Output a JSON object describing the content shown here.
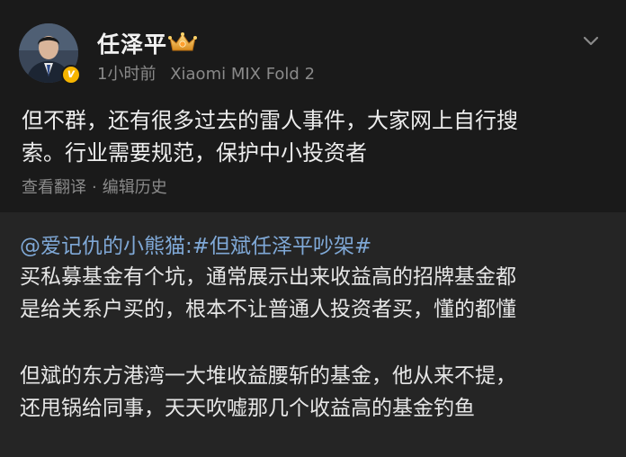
{
  "post": {
    "author": {
      "name": "任泽平"
    },
    "time": "1小时前",
    "device": "Xiaomi MIX Fold 2",
    "text_line1": "但不群，还有很多过去的雷人事件，大家网上自行搜",
    "text_line2": "索。行业需要规范，保护中小投资者",
    "actions": {
      "translate": "查看翻译",
      "separator": "·",
      "edit_history": "编辑历史"
    }
  },
  "repost": {
    "mention": "@爱记仇的小熊猫",
    "colon": ":",
    "topic": "#但斌任泽平吵架#",
    "para1_line1": "买私募基金有个坑，通常展示出来收益高的招牌基金都",
    "para1_line2": "是给关系户买的，根本不让普通人投资者买，懂的都懂",
    "para2_line1": "但斌的东方港湾一大堆收益腰斩的基金，他从来不提，",
    "para2_line2": "还甩锅给同事，天天吹嘘那几个收益高的基金钓鱼"
  },
  "icons": {
    "verified_badge": "verified-v-badge",
    "vip": "crown-icon",
    "menu": "chevron-down-icon"
  },
  "colors": {
    "background": "#1a1a1a",
    "repost_background": "#252525",
    "link": "#7fa8d6",
    "secondary_text": "#8a8a8a",
    "verified": "#f7b500"
  }
}
